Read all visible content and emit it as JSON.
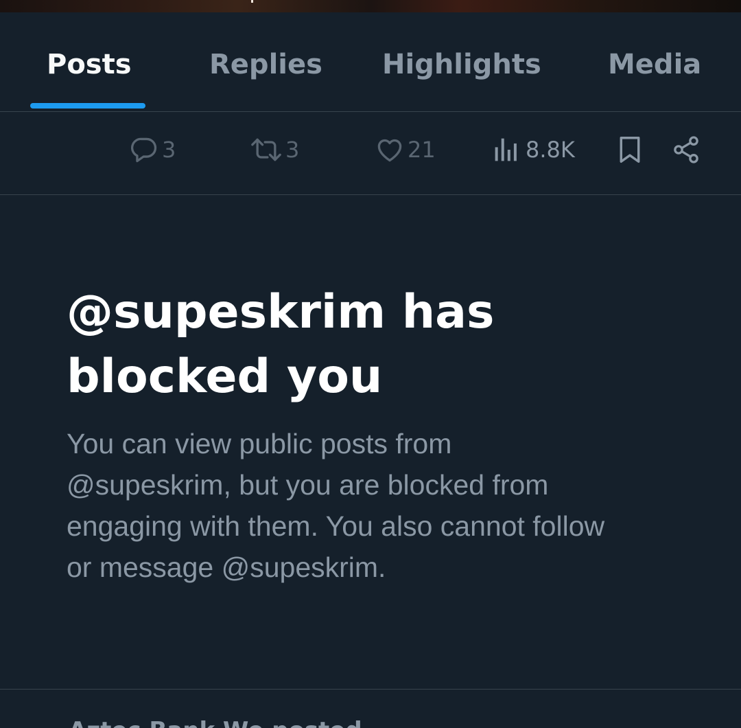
{
  "tabs": [
    {
      "label": "Posts",
      "active": true
    },
    {
      "label": "Replies",
      "active": false
    },
    {
      "label": "Highlights",
      "active": false
    },
    {
      "label": "Media",
      "active": false
    }
  ],
  "post_actions": {
    "reply": {
      "icon": "reply-icon",
      "count": "3"
    },
    "repost": {
      "icon": "repost-icon",
      "count": "3"
    },
    "like": {
      "icon": "like-icon",
      "count": "21"
    },
    "views": {
      "icon": "views-icon",
      "count": "8.8K"
    },
    "bookmark": {
      "icon": "bookmark-icon"
    },
    "share": {
      "icon": "share-icon"
    }
  },
  "block_notice": {
    "title": "@supeskrim has blocked you",
    "body": "You can view public posts from @supeskrim, but you are blocked from engaging with them. You also cannot follow or message @supeskrim."
  },
  "next_post_preview": "Aztec Bank We posted",
  "colors": {
    "background": "#15202b",
    "accent": "#1d9bf0",
    "divider": "#38444d",
    "secondary_text": "#8b98a5"
  }
}
